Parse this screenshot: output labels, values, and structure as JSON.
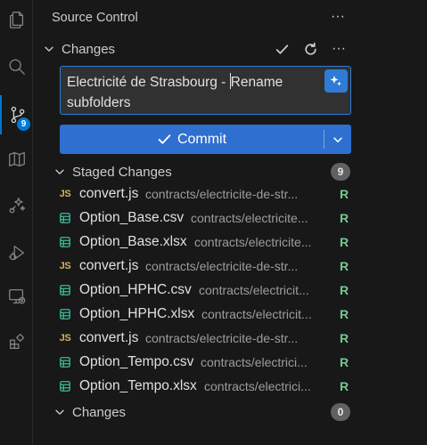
{
  "sidebar": {
    "title": "Source Control",
    "more_label": "···"
  },
  "changes_section": {
    "label": "Changes",
    "more_label": "···"
  },
  "commit_message": {
    "text_before_caret": "Electricité de Strasbourg - ",
    "text_after_caret": "Rename subfolders"
  },
  "commit_button": {
    "label": "Commit"
  },
  "staged": {
    "label": "Staged Changes",
    "count": "9",
    "files": [
      {
        "name": "convert.js",
        "path": "contracts/electricite-de-str...",
        "status": "R",
        "type": "js"
      },
      {
        "name": "Option_Base.csv",
        "path": "contracts/electricite...",
        "status": "R",
        "type": "csv"
      },
      {
        "name": "Option_Base.xlsx",
        "path": "contracts/electricite...",
        "status": "R",
        "type": "csv"
      },
      {
        "name": "convert.js",
        "path": "contracts/electricite-de-str...",
        "status": "R",
        "type": "js"
      },
      {
        "name": "Option_HPHC.csv",
        "path": "contracts/electricit...",
        "status": "R",
        "type": "csv"
      },
      {
        "name": "Option_HPHC.xlsx",
        "path": "contracts/electricit...",
        "status": "R",
        "type": "csv"
      },
      {
        "name": "convert.js",
        "path": "contracts/electricite-de-str...",
        "status": "R",
        "type": "js"
      },
      {
        "name": "Option_Tempo.csv",
        "path": "contracts/electrici...",
        "status": "R",
        "type": "csv"
      },
      {
        "name": "Option_Tempo.xlsx",
        "path": "contracts/electrici...",
        "status": "R",
        "type": "csv"
      }
    ]
  },
  "unstaged": {
    "label": "Changes",
    "count": "0"
  },
  "activity_bar": {
    "scm_badge": "9",
    "icons": [
      "explorer-icon",
      "search-icon",
      "source-control-icon",
      "map-icon",
      "sparkle-bug-icon",
      "run-debug-icon",
      "remote-explorer-icon",
      "extensions-icon"
    ]
  },
  "colors": {
    "accent": "#2f6fcf",
    "status_renamed": "#73c991",
    "js_icon": "#d6b25b",
    "csv_icon": "#3fb89b"
  }
}
